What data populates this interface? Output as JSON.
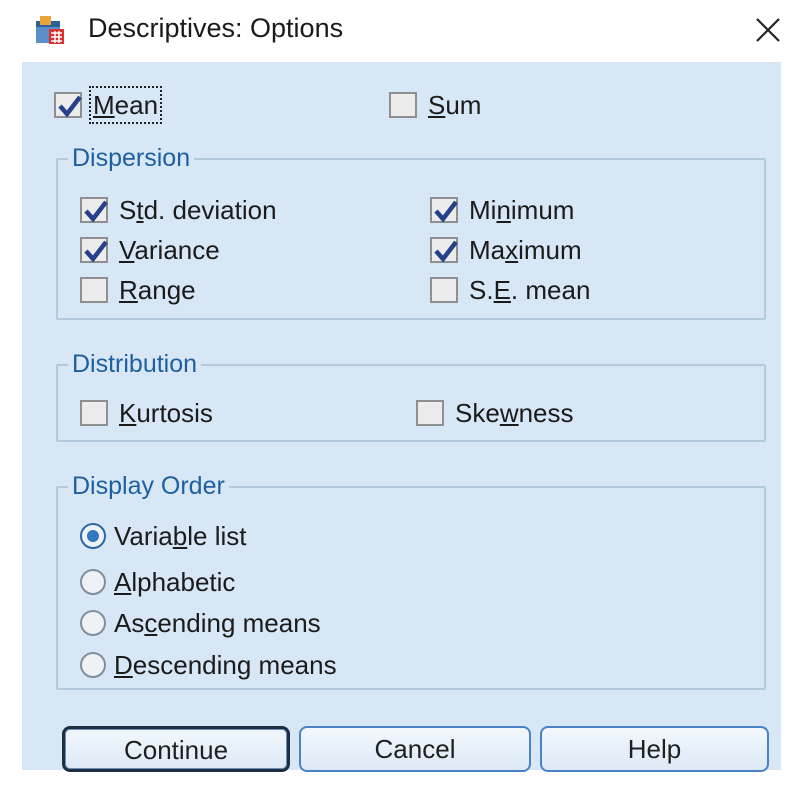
{
  "window": {
    "title": "Descriptives: Options"
  },
  "top": {
    "mean_label": "Mean",
    "sum_label": "Sum",
    "mean_checked": true,
    "sum_checked": false
  },
  "dispersion": {
    "legend": "Dispersion",
    "items": [
      {
        "label": "Std. deviation",
        "checked": true
      },
      {
        "label": "Minimum",
        "checked": true
      },
      {
        "label": "Variance",
        "checked": true
      },
      {
        "label": "Maximum",
        "checked": true
      },
      {
        "label": "Range",
        "checked": false
      },
      {
        "label": "S.E. mean",
        "checked": false
      }
    ]
  },
  "distribution": {
    "legend": "Distribution",
    "items": [
      {
        "label": "Kurtosis",
        "checked": false
      },
      {
        "label": "Skewness",
        "checked": false
      }
    ]
  },
  "display_order": {
    "legend": "Display Order",
    "options": [
      {
        "label": "Variable list",
        "selected": true
      },
      {
        "label": "Alphabetic",
        "selected": false
      },
      {
        "label": "Ascending means",
        "selected": false
      },
      {
        "label": "Descending means",
        "selected": false
      }
    ]
  },
  "buttons": {
    "continue": "Continue",
    "cancel": "Cancel",
    "help": "Help"
  },
  "icons": {
    "app": "spss-table-icon",
    "close": "close-icon",
    "check": "checkmark-icon",
    "radio": "radio-button-icon"
  },
  "colors": {
    "client_bg": "#d7e7f5",
    "legend_text": "#1e5f9f",
    "group_border": "#b3c9dc",
    "check": "#26408b",
    "button_border": "#4a82c6"
  }
}
